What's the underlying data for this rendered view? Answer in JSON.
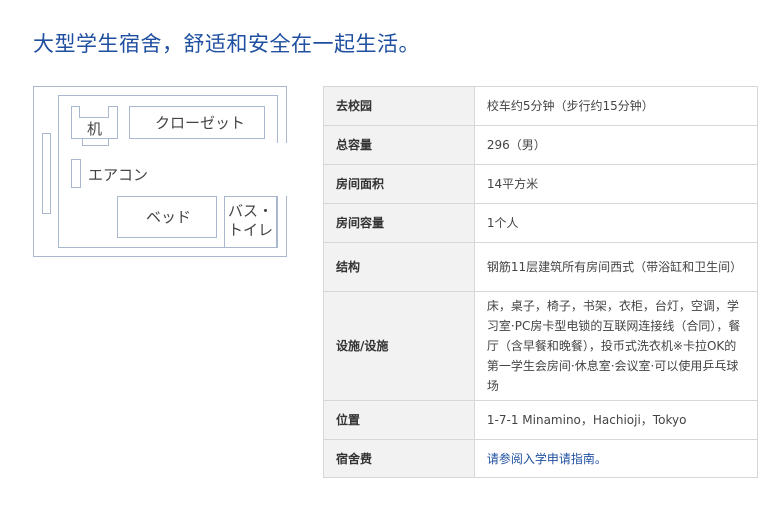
{
  "title": "大型学生宿舍，舒适和安全在一起生活。",
  "floor_plan": {
    "desk": "机",
    "closet": "クローゼット",
    "aircon": "エアコン",
    "bed": "ベッド",
    "bath_line1": "バス・",
    "bath_line2": "トイレ"
  },
  "rows": [
    {
      "label": "去校园",
      "value": "校车约5分钟（步行约15分钟）"
    },
    {
      "label": "总容量",
      "value": "296（男）"
    },
    {
      "label": "房间面积",
      "value": "14平方米"
    },
    {
      "label": "房间容量",
      "value": "1个人"
    },
    {
      "label": "结构",
      "value": "钢筋11层建筑所有房间西式（带浴缸和卫生间）"
    },
    {
      "label": "设施/设施",
      "value": "床，桌子，椅子，书架，衣柜，台灯，空调，学习室·PC房卡型电锁的互联网连接线（合同），餐厅（含早餐和晚餐），投币式洗衣机※卡拉OK的第一学生会房间·休息室·会议室·可以使用乒乓球场"
    },
    {
      "label": "位置",
      "value": "1-7-1 Minamino，Hachioji，Tokyo"
    },
    {
      "label": "宿舍费",
      "value": "请参阅入学申请指南。"
    }
  ]
}
